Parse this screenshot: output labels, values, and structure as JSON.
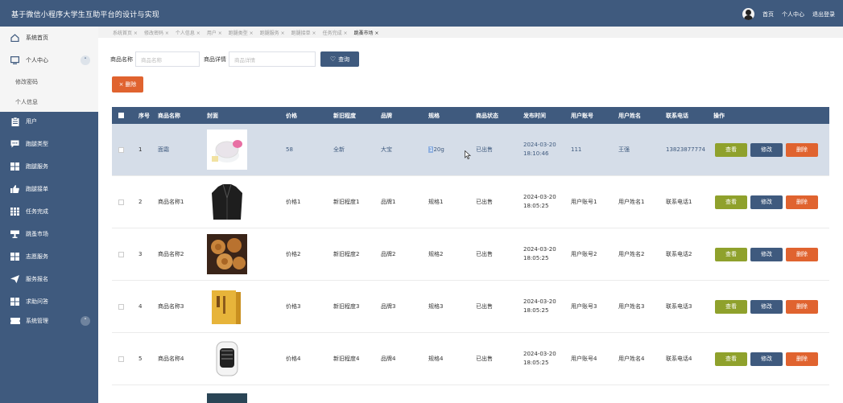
{
  "app": {
    "title": "基于微信小程序大学生互助平台的设计与实现",
    "links": {
      "home": "首页",
      "profile": "个人中心",
      "logout": "退出登录"
    }
  },
  "sidebar": {
    "home": "系统首页",
    "personal": "个人中心",
    "change_password": "修改密码",
    "personal_info": "个人信息",
    "items": [
      "用户",
      "跑腿类型",
      "跑腿服务",
      "跑腿接单",
      "任务完成",
      "跳蚤市场",
      "志愿服务",
      "服务报名",
      "求助问答",
      "系统管理"
    ]
  },
  "tabs": [
    "系统首页 ×",
    "修改密码 ×",
    "个人信息 ×",
    "用户 ×",
    "跑腿类型 ×",
    "跑腿服务 ×",
    "跑腿接单 ×",
    "任务完成 ×",
    "跳蚤市场 ×"
  ],
  "search": {
    "name_label": "商品名称",
    "name_placeholder": "商品名称",
    "detail_label": "商品详情",
    "detail_placeholder": "商品详情",
    "query_button": "查询"
  },
  "delete_button": "删除",
  "table": {
    "headers": [
      "序号",
      "商品名称",
      "封面",
      "价格",
      "新旧程度",
      "品牌",
      "规格",
      "商品状态",
      "发布时间",
      "用户账号",
      "用户姓名",
      "联系电话",
      "操作"
    ],
    "rows": [
      {
        "index": "1",
        "name": "面霜",
        "price": "58",
        "condition": "全新",
        "brand": "大宝",
        "spec_hl": "1",
        "spec": "20g",
        "status": "已出售",
        "time": "2024-03-20 18:10:46",
        "account": "111",
        "username": "王强",
        "phone": "13823877774"
      },
      {
        "index": "2",
        "name": "商品名称1",
        "price": "价格1",
        "condition": "新旧程度1",
        "brand": "品牌1",
        "spec_hl": "",
        "spec": "规格1",
        "status": "已出售",
        "time": "2024-03-20 18:05:25",
        "account": "用户账号1",
        "username": "用户姓名1",
        "phone": "联系电话1"
      },
      {
        "index": "3",
        "name": "商品名称2",
        "price": "价格2",
        "condition": "新旧程度2",
        "brand": "品牌2",
        "spec_hl": "",
        "spec": "规格2",
        "status": "已出售",
        "time": "2024-03-20 18:05:25",
        "account": "用户账号2",
        "username": "用户姓名2",
        "phone": "联系电话2"
      },
      {
        "index": "4",
        "name": "商品名称3",
        "price": "价格3",
        "condition": "新旧程度3",
        "brand": "品牌3",
        "spec_hl": "",
        "spec": "规格3",
        "status": "已出售",
        "time": "2024-03-20 18:05:25",
        "account": "用户账号3",
        "username": "用户姓名3",
        "phone": "联系电话3"
      },
      {
        "index": "5",
        "name": "商品名称4",
        "price": "价格4",
        "condition": "新旧程度4",
        "brand": "品牌4",
        "spec_hl": "",
        "spec": "规格4",
        "status": "已出售",
        "time": "2024-03-20 18:05:25",
        "account": "用户账号4",
        "username": "用户姓名4",
        "phone": "联系电话4"
      }
    ],
    "actions": {
      "view": "查看",
      "edit": "修改",
      "delete": "删除"
    }
  },
  "colors": {
    "primary": "#3f5a7e",
    "view": "#8fa12c",
    "delete": "#e0632f",
    "selected_row": "#d5dde8"
  }
}
